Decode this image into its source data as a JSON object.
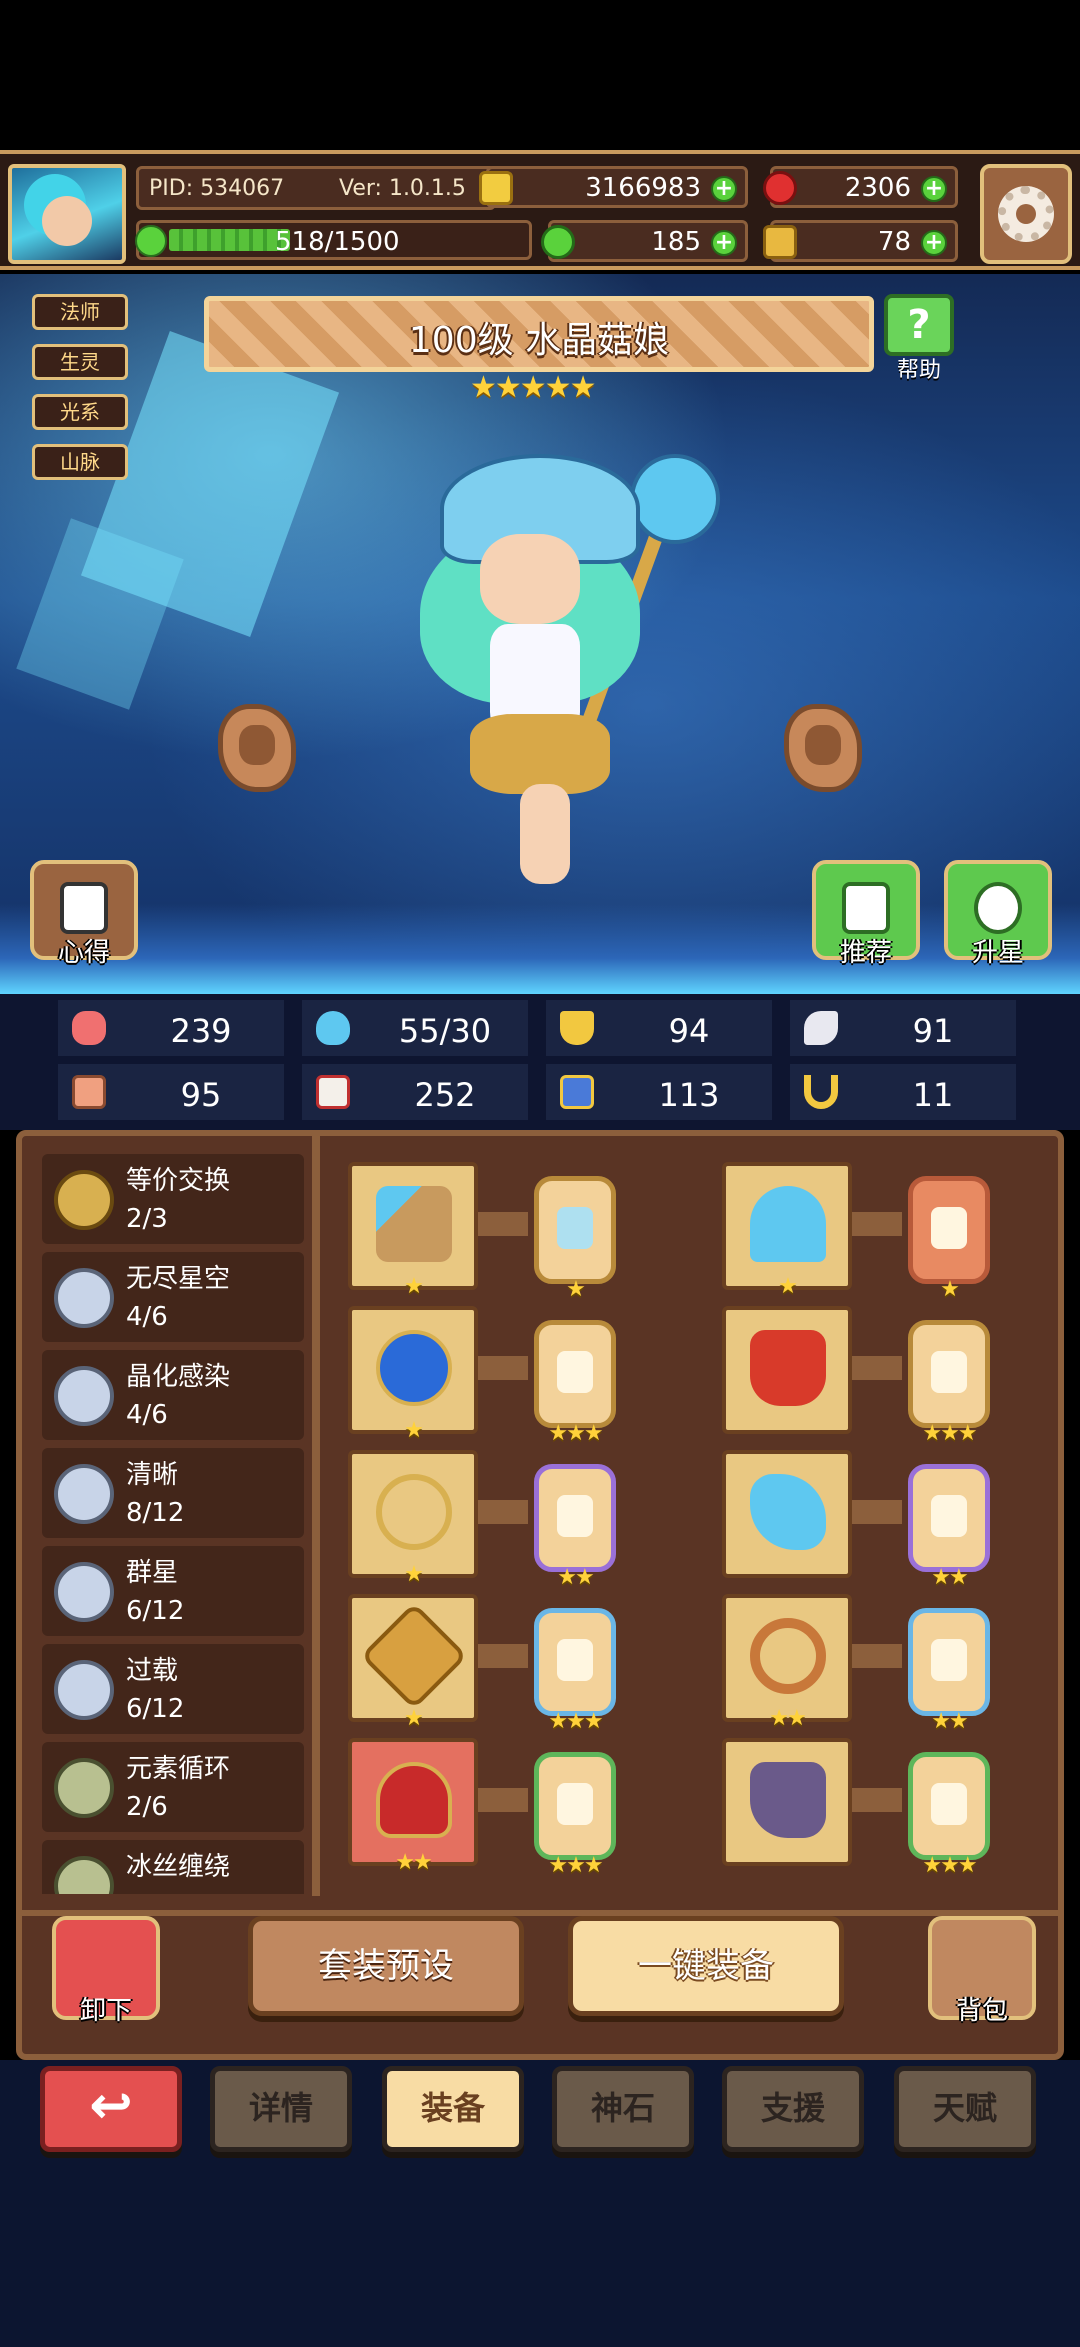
{
  "header": {
    "pid": "PID: 534067",
    "version": "Ver: 1.0.1.5",
    "xp_text": "518/1500",
    "xp_fraction": 0.3453,
    "gold": "3166983",
    "gems": "2306",
    "clover": "185",
    "key": "78"
  },
  "tags": [
    "法师",
    "生灵",
    "光系",
    "山脉"
  ],
  "hero": {
    "title": "100级 水晶菇娘",
    "stars": "★★★★★",
    "help_label": "帮助",
    "notes_label": "心得",
    "recommend_label": "推荐",
    "upstar_label": "升星"
  },
  "stats": [
    "239",
    "55/30",
    "94",
    "91",
    "95",
    "252",
    "113",
    "11"
  ],
  "sets": [
    {
      "name": "等价交换",
      "count": "2/3"
    },
    {
      "name": "无尽星空",
      "count": "4/6"
    },
    {
      "name": "晶化感染",
      "count": "4/6"
    },
    {
      "name": "清晰",
      "count": "8/12"
    },
    {
      "name": "群星",
      "count": "6/12"
    },
    {
      "name": "过载",
      "count": "6/12"
    },
    {
      "name": "元素循环",
      "count": "2/6"
    },
    {
      "name": "冰丝缠绕",
      "count": ""
    }
  ],
  "equipment": [
    {
      "stars": "★",
      "gem_stars": "★"
    },
    {
      "stars": "★",
      "gem_stars": "★"
    },
    {
      "stars": "★",
      "gem_stars": "★★★"
    },
    {
      "stars": "",
      "gem_stars": "★★★"
    },
    {
      "stars": "★",
      "gem_stars": "★★"
    },
    {
      "stars": "",
      "gem_stars": "★★"
    },
    {
      "stars": "★",
      "gem_stars": "★★★"
    },
    {
      "stars": "★★",
      "gem_stars": "★★"
    },
    {
      "stars": "★★",
      "gem_stars": "★★★"
    },
    {
      "stars": "",
      "gem_stars": "★★★"
    }
  ],
  "actions": {
    "unequip": "卸下",
    "preset": "套装预设",
    "auto_equip": "一键装备",
    "bag": "背包"
  },
  "tabs": {
    "back": "↩",
    "details": "详情",
    "equip": "装备",
    "stone": "神石",
    "support": "支援",
    "talent": "天赋"
  }
}
